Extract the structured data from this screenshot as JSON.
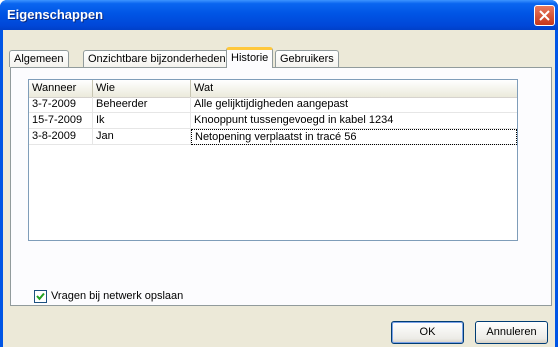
{
  "window": {
    "title": "Eigenschappen"
  },
  "tabs": [
    {
      "label": "Algemeen"
    },
    {
      "label": "Onzichtbare bijzonderheden"
    },
    {
      "label": "Historie"
    },
    {
      "label": "Gebruikers"
    }
  ],
  "active_tab": "Historie",
  "list": {
    "columns": [
      "Wanneer",
      "Wie",
      "Wat"
    ],
    "rows": [
      [
        "3-7-2009",
        "Beheerder",
        "Alle gelijktijdigheden aangepast"
      ],
      [
        "15-7-2009",
        "Ik",
        "Knooppunt tussengevoegd in kabel 1234"
      ],
      [
        "3-8-2009",
        "Jan",
        "Netopening verplaatst in tracé 56"
      ]
    ]
  },
  "checkbox": {
    "label": "Vragen bij netwerk opslaan",
    "checked": true
  },
  "buttons": {
    "ok": "OK",
    "cancel": "Annuleren"
  },
  "colors": {
    "titlebar": "#0055e5",
    "dialog_bg": "#ece9d8",
    "active_tab_accent": "#ffc83c"
  }
}
